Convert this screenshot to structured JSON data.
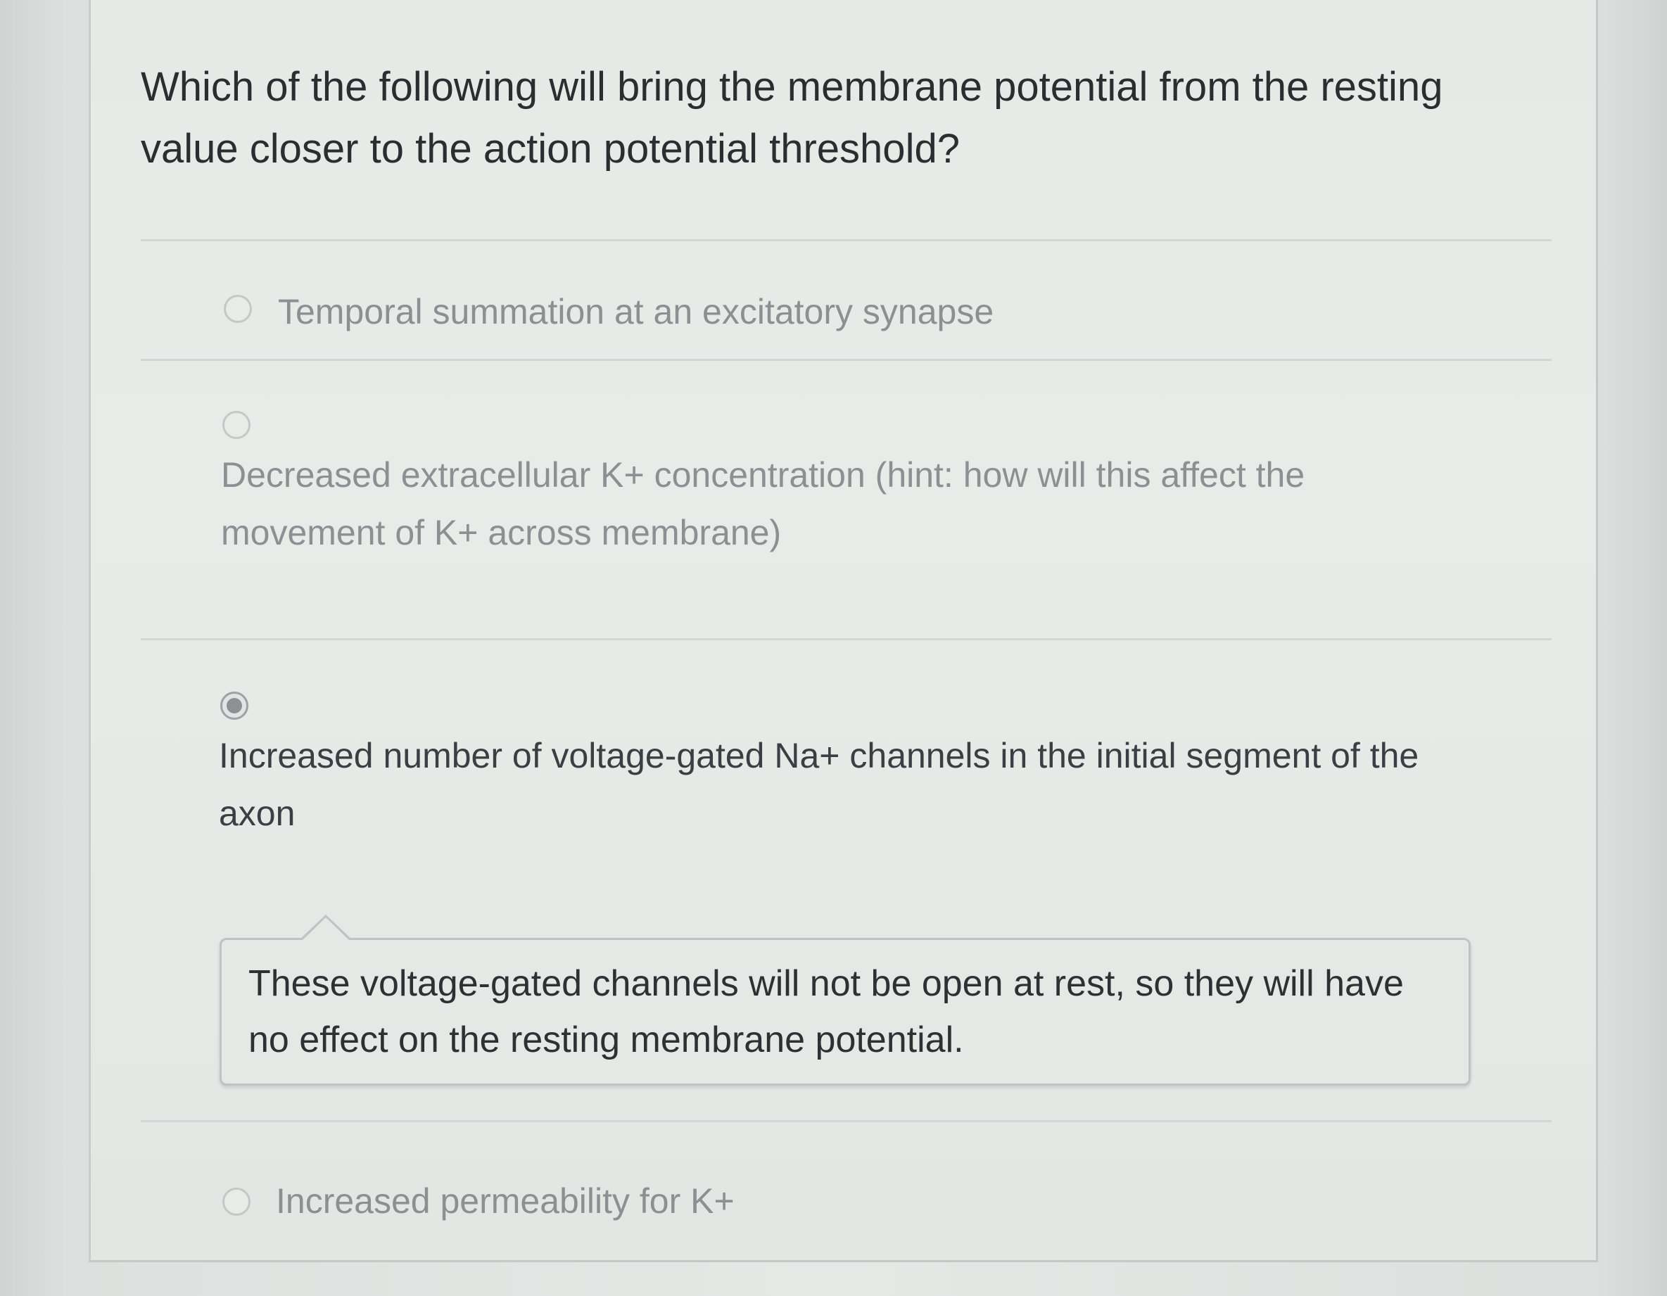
{
  "question": {
    "text": "Which of the following will bring the membrane potential from the resting value closer to the action potential threshold?"
  },
  "options": [
    {
      "label": "Temporal summation at an excitatory synapse",
      "selected": false
    },
    {
      "label": "Decreased extracellular K+ concentration (hint: how will this affect the movement of K+ across membrane)",
      "selected": false
    },
    {
      "label": "Increased number of voltage-gated Na+ channels in the initial segment of the axon",
      "selected": true
    },
    {
      "label": "Increased permeability for K+",
      "selected": false
    }
  ],
  "feedback": {
    "text": "These voltage-gated channels will not be open at rest, so they will have no effect on the resting membrane potential."
  }
}
